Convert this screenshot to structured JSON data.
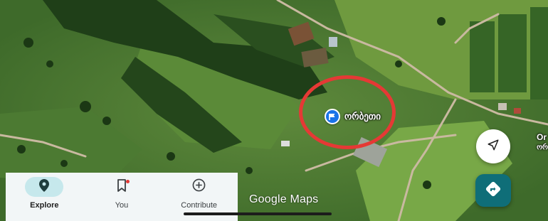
{
  "map": {
    "place_label": "ორბეთი",
    "edge_label_top": "Or",
    "edge_label_bottom": "ორ",
    "attribution": "Google Maps"
  },
  "fabs": {
    "locate_icon": "navigation-arrow-icon",
    "directions_icon": "directions-icon"
  },
  "bottom_nav": {
    "items": [
      {
        "label": "Explore",
        "icon": "location-pin-icon",
        "active": true
      },
      {
        "label": "You",
        "icon": "bookmark-icon",
        "active": false,
        "badge": true
      },
      {
        "label": "Contribute",
        "icon": "add-circle-icon",
        "active": false
      }
    ]
  },
  "colors": {
    "highlight": "#e53935",
    "pin": "#1a73e8",
    "directions_fab": "#0f6e78",
    "active_pill": "#c6e8ec"
  }
}
